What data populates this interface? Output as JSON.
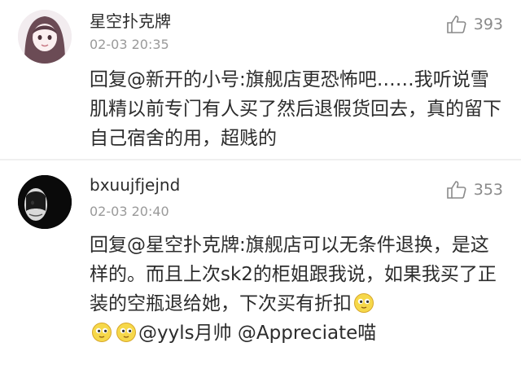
{
  "comments": [
    {
      "username": "星空扑克牌",
      "time": "02-03 20:35",
      "likes": "393",
      "body": "回复@新开的小号:旗舰店更恐怖吧……我听说雪肌精以前专门有人买了然后退假货回去，真的留下自己宿舍的用，超贱的"
    },
    {
      "username": "bxuujfjejnd",
      "time": "02-03 20:40",
      "likes": "353",
      "body_part1": "回复@星空扑克牌:旗舰店可以无条件退换，是这样的。而且上次sk2的柜姐跟我说，如果我买了正装的空瓶退给她，下次买有折扣",
      "body_part2": "@yyls月帅 @Appreciate喵"
    }
  ],
  "icons": {
    "like": "thumbs-up-icon",
    "emoji": "emoji-face-icon"
  }
}
